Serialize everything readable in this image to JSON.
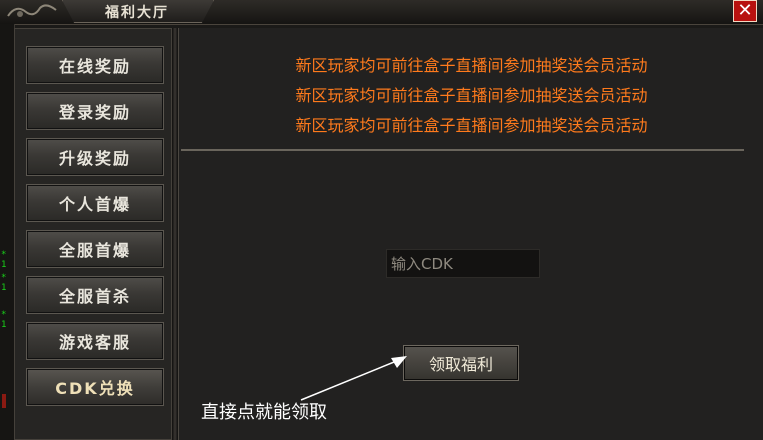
{
  "window": {
    "title": "福利大厅",
    "close_glyph": "✕"
  },
  "side_strip": {
    "lines": [
      "* 1",
      "* 1",
      "* 1"
    ]
  },
  "sidebar": {
    "items": [
      {
        "label": "在线奖励"
      },
      {
        "label": "登录奖励"
      },
      {
        "label": "升级奖励"
      },
      {
        "label": "个人首爆"
      },
      {
        "label": "全服首爆"
      },
      {
        "label": "全服首杀"
      },
      {
        "label": "游戏客服"
      },
      {
        "label": "CDK兑换"
      }
    ],
    "active_index": 7
  },
  "content": {
    "notices": [
      "新区玩家均可前往盒子直播间参加抽奖送会员活动",
      "新区玩家均可前往盒子直播间参加抽奖送会员活动",
      "新区玩家均可前往盒子直播间参加抽奖送会员活动"
    ],
    "cdk_input": {
      "placeholder": "输入CDK",
      "value": ""
    },
    "claim_button": "领取福利",
    "hint": "直接点就能领取"
  },
  "colors": {
    "notice": "#ff7a1c",
    "close_bg": "#b8120f",
    "strip_text": "#19d119"
  }
}
